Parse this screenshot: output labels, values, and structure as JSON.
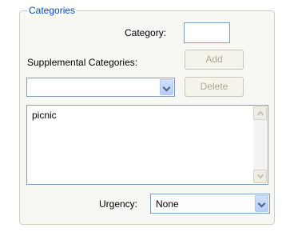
{
  "group": {
    "title": "Categories"
  },
  "category": {
    "label": "Category:",
    "value": ""
  },
  "supplemental": {
    "label": "Supplemental Categories:",
    "combo_value": "",
    "add_label": "Add",
    "delete_label": "Delete",
    "items": [
      "picnic"
    ]
  },
  "urgency": {
    "label": "Urgency:",
    "value": "None"
  }
}
